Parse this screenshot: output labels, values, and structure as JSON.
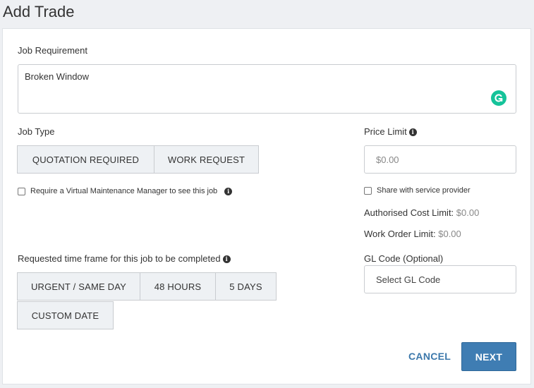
{
  "page": {
    "title": "Add Trade"
  },
  "job_requirement": {
    "label": "Job Requirement",
    "value": "Broken Window"
  },
  "job_type": {
    "label": "Job Type",
    "options": [
      "QUOTATION REQUIRED",
      "WORK REQUEST"
    ]
  },
  "vmm_checkbox": {
    "label": "Require a Virtual Maintenance Manager to see this job",
    "checked": false
  },
  "timeframe": {
    "label": "Requested time frame for this job to be completed",
    "options": [
      "URGENT / SAME DAY",
      "48 HOURS",
      "5 DAYS",
      "CUSTOM DATE"
    ]
  },
  "price_limit": {
    "label": "Price Limit",
    "placeholder": "$0.00"
  },
  "share_checkbox": {
    "label": "Share with service provider",
    "checked": false
  },
  "authorised_cost": {
    "label": "Authorised Cost Limit:",
    "value": "$0.00"
  },
  "work_order": {
    "label": "Work Order Limit:",
    "value": "$0.00"
  },
  "gl_code": {
    "label": "GL Code (Optional)",
    "placeholder": "Select GL Code"
  },
  "actions": {
    "cancel": "CANCEL",
    "next": "NEXT"
  },
  "colors": {
    "primary": "#3f7db3",
    "link": "#3c78ab",
    "grammarly": "#15c39a"
  }
}
